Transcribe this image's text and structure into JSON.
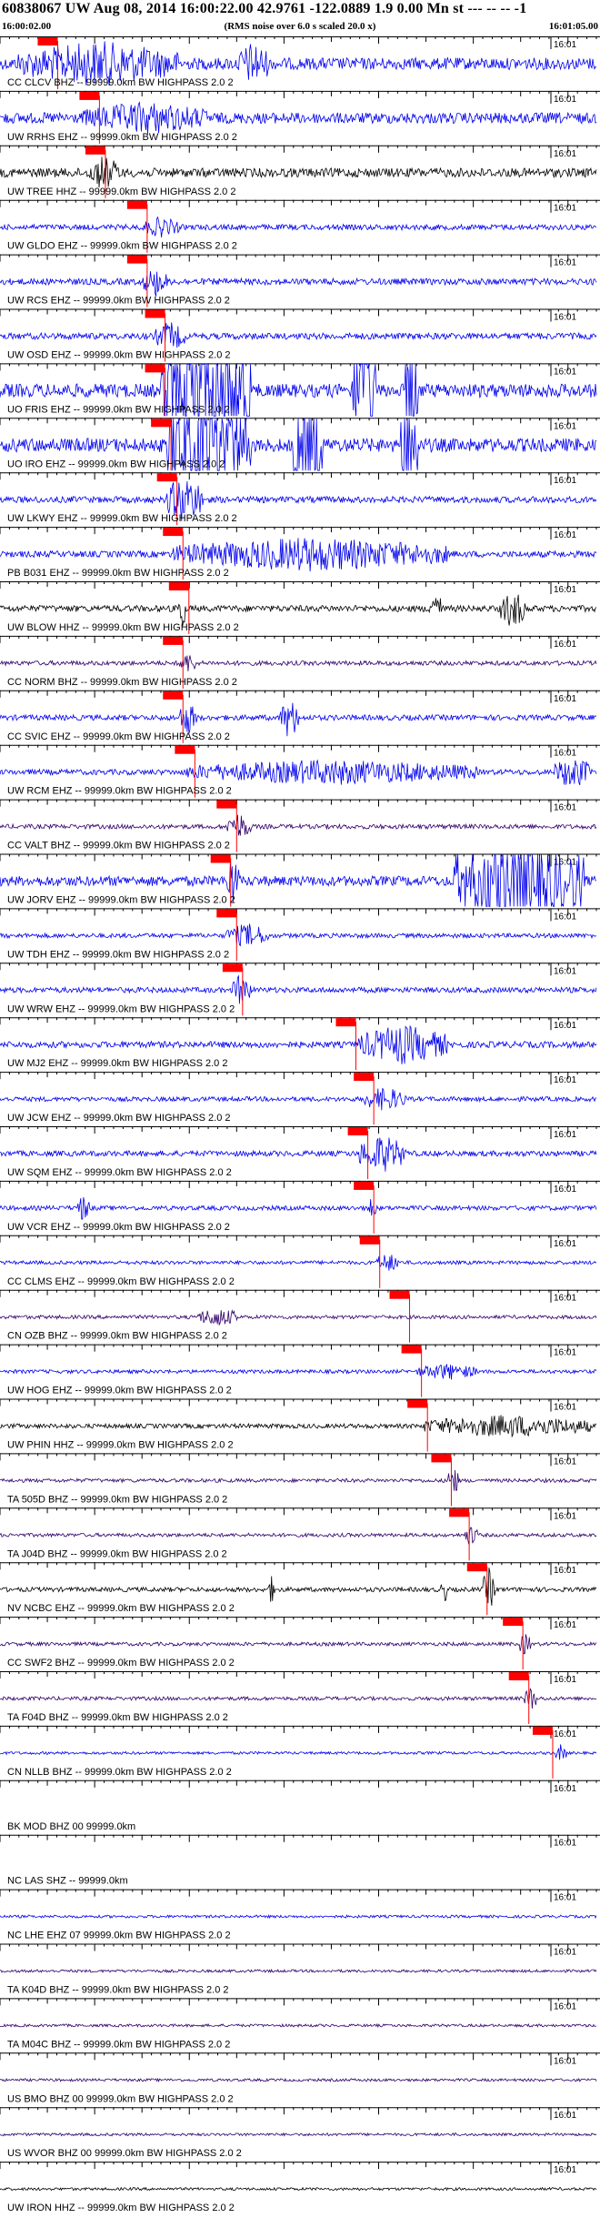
{
  "header": {
    "title": "60838067 UW Aug 08, 2014 16:00:22.00   42.9761 -122.0889  1.9 0.00 Mn st --- -- --   -1",
    "start_time": "16:00:02.00",
    "rms_note": "(RMS noise over 6.0 s scaled 20.0 x)",
    "end_time": "16:01:05.00"
  },
  "tick_label": "16:01",
  "colors": {
    "blue": "#0000ee",
    "black": "#000000",
    "purple": "#30006a",
    "pick": "#ff0000"
  },
  "traces": [
    {
      "label": "CC CLCV BHZ -- 99999.0km BW  HIGHPASS  2.0  2",
      "color": "blue",
      "pick": 0.08,
      "amp": 26,
      "bursts": [
        [
          0.03,
          0.3,
          1.0
        ],
        [
          0.4,
          0.45,
          1.0
        ]
      ]
    },
    {
      "label": "UW RRHS EHZ -- 99999.0km BW  HIGHPASS  2.0  2",
      "color": "blue",
      "pick": 0.15,
      "amp": 24,
      "bursts": [
        [
          0.14,
          0.35,
          0.8
        ]
      ]
    },
    {
      "label": "UW TREE HHZ -- 99999.0km BW  HIGHPASS  2.0  2",
      "color": "black",
      "pick": 0.16,
      "amp": 20,
      "bursts": [
        [
          0.15,
          0.2,
          1.0
        ]
      ]
    },
    {
      "label": "UW GLDO EHZ -- 99999.0km BW  HIGHPASS  2.0  2",
      "color": "blue",
      "pick": 0.23,
      "amp": 12,
      "bursts": [
        [
          0.24,
          0.3,
          1.0
        ]
      ]
    },
    {
      "label": "UW RCS EHZ -- 99999.0km BW  HIGHPASS  2.0  2",
      "color": "blue",
      "pick": 0.23,
      "amp": 14,
      "bursts": [
        [
          0.24,
          0.28,
          1.2
        ]
      ]
    },
    {
      "label": "UW OSD EHZ -- 99999.0km BW  HIGHPASS  2.0  2",
      "color": "blue",
      "pick": 0.26,
      "amp": 14,
      "bursts": [
        [
          0.26,
          0.31,
          1.2
        ]
      ]
    },
    {
      "label": "UO FRIS EHZ -- 99999.0km BW  HIGHPASS  2.0  2",
      "color": "blue",
      "pick": 0.26,
      "amp": 30,
      "bursts": [
        [
          0.27,
          0.42,
          3.0
        ],
        [
          0.59,
          0.63,
          3.0
        ],
        [
          0.68,
          0.7,
          3.0
        ]
      ]
    },
    {
      "label": "UO IRO EHZ -- 99999.0km BW  HIGHPASS  2.0  2",
      "color": "blue",
      "pick": 0.27,
      "amp": 30,
      "bursts": [
        [
          0.28,
          0.42,
          2.5
        ],
        [
          0.49,
          0.54,
          2.5
        ],
        [
          0.67,
          0.7,
          2.5
        ]
      ]
    },
    {
      "label": "UW LKWY EHZ -- 99999.0km BW  HIGHPASS  2.0  2",
      "color": "blue",
      "pick": 0.28,
      "amp": 14,
      "bursts": [
        [
          0.28,
          0.34,
          2.0
        ]
      ]
    },
    {
      "label": "PB B031 EHZ -- 99999.0km BW  HIGHPASS  2.0  2",
      "color": "blue",
      "pick": 0.29,
      "amp": 14,
      "bursts": [
        [
          0.29,
          0.75,
          1.4
        ]
      ]
    },
    {
      "label": "UW BLOW HHZ -- 99999.0km BW  HIGHPASS  2.0  2",
      "color": "black",
      "pick": 0.3,
      "amp": 14,
      "bursts": [
        [
          0.3,
          0.31,
          2.2
        ],
        [
          0.72,
          0.74,
          1.6
        ],
        [
          0.84,
          0.88,
          1.6
        ]
      ]
    },
    {
      "label": "CC NORM BHZ -- 99999.0km BW  HIGHPASS  2.0  2",
      "color": "purple",
      "pick": 0.29,
      "amp": 10,
      "bursts": [
        [
          0.3,
          0.33,
          1.2
        ]
      ]
    },
    {
      "label": "CC SVIC EHZ -- 99999.0km BW  HIGHPASS  2.0  2",
      "color": "blue",
      "pick": 0.29,
      "amp": 12,
      "bursts": [
        [
          0.3,
          0.33,
          1.6
        ],
        [
          0.47,
          0.5,
          2.0
        ]
      ]
    },
    {
      "label": "UW RCM EHZ -- 99999.0km BW  HIGHPASS  2.0  2",
      "color": "blue",
      "pick": 0.31,
      "amp": 12,
      "bursts": [
        [
          0.31,
          0.8,
          1.2
        ],
        [
          0.93,
          0.99,
          1.6
        ]
      ]
    },
    {
      "label": "CC VALT BHZ -- 99999.0km BW  HIGHPASS  2.0  2",
      "color": "purple",
      "pick": 0.38,
      "amp": 10,
      "bursts": [
        [
          0.38,
          0.42,
          1.6
        ]
      ]
    },
    {
      "label": "UW JORV EHZ -- 99999.0km BW  HIGHPASS  2.0  2",
      "color": "blue",
      "pick": 0.37,
      "amp": 22,
      "bursts": [
        [
          0.38,
          0.4,
          1.4
        ],
        [
          0.76,
          0.98,
          2.6
        ]
      ]
    },
    {
      "label": "UW TDH EHZ -- 99999.0km BW  HIGHPASS  2.0  2",
      "color": "blue",
      "pick": 0.38,
      "amp": 10,
      "bursts": [
        [
          0.38,
          0.45,
          1.4
        ]
      ]
    },
    {
      "label": "UW WRW EHZ -- 99999.0km BW  HIGHPASS  2.0  2",
      "color": "blue",
      "pick": 0.39,
      "amp": 12,
      "bursts": [
        [
          0.39,
          0.42,
          1.6
        ]
      ]
    },
    {
      "label": "UW MJ2 EHZ -- 99999.0km BW  HIGHPASS  2.0  2",
      "color": "blue",
      "pick": 0.58,
      "amp": 14,
      "bursts": [
        [
          0.6,
          0.75,
          1.6
        ]
      ]
    },
    {
      "label": "UW JCW EHZ -- 99999.0km BW  HIGHPASS  2.0  2",
      "color": "blue",
      "pick": 0.61,
      "amp": 10,
      "bursts": [
        [
          0.61,
          0.68,
          1.4
        ]
      ]
    },
    {
      "label": "UW SQM EHZ -- 99999.0km BW  HIGHPASS  2.0  2",
      "color": "blue",
      "pick": 0.6,
      "amp": 12,
      "bursts": [
        [
          0.6,
          0.68,
          1.8
        ]
      ]
    },
    {
      "label": "UW VCR EHZ -- 99999.0km BW  HIGHPASS  2.0  2",
      "color": "blue",
      "pick": 0.61,
      "amp": 10,
      "bursts": [
        [
          0.13,
          0.15,
          1.6
        ],
        [
          0.62,
          0.63,
          2.0
        ]
      ]
    },
    {
      "label": "CC CLMS EHZ -- 99999.0km BW  HIGHPASS  2.0  2",
      "color": "blue",
      "pick": 0.62,
      "amp": 8,
      "bursts": [
        [
          0.63,
          0.67,
          1.4
        ]
      ]
    },
    {
      "label": "CN OZB BHZ -- 99999.0km BW  HIGHPASS  2.0  2",
      "color": "purple",
      "pick": 0.67,
      "amp": 8,
      "bursts": [
        [
          0.33,
          0.4,
          1.4
        ]
      ]
    },
    {
      "label": "UW HOG EHZ -- 99999.0km BW  HIGHPASS  2.0  2",
      "color": "blue",
      "pick": 0.69,
      "amp": 8,
      "bursts": [
        [
          0.7,
          0.8,
          1.2
        ]
      ]
    },
    {
      "label": "UW PHIN HHZ -- 99999.0km BW  HIGHPASS  2.0  2",
      "color": "black",
      "pick": 0.7,
      "amp": 10,
      "bursts": [
        [
          0.71,
          0.99,
          1.3
        ]
      ]
    },
    {
      "label": "TA 505D BHZ -- 99999.0km BW  HIGHPASS  2.0  2",
      "color": "purple",
      "pick": 0.74,
      "amp": 8,
      "bursts": [
        [
          0.75,
          0.77,
          2.2
        ]
      ]
    },
    {
      "label": "TA J04D BHZ -- 99999.0km BW  HIGHPASS  2.0  2",
      "color": "purple",
      "pick": 0.77,
      "amp": 8,
      "bursts": [
        [
          0.78,
          0.8,
          1.6
        ]
      ]
    },
    {
      "label": "NV NCBC EHZ -- 99999.0km BW  HIGHPASS  2.0  2",
      "color": "black",
      "pick": 0.8,
      "amp": 10,
      "bursts": [
        [
          0.81,
          0.83,
          2.4
        ],
        [
          0.45,
          0.46,
          1.6
        ],
        [
          0.74,
          0.75,
          1.6
        ]
      ]
    },
    {
      "label": "CC SWF2 BHZ -- 99999.0km BW  HIGHPASS  2.0  2",
      "color": "purple",
      "pick": 0.86,
      "amp": 8,
      "bursts": [
        [
          0.87,
          0.89,
          1.6
        ]
      ]
    },
    {
      "label": "TA F04D BHZ -- 99999.0km BW  HIGHPASS  2.0  2",
      "color": "purple",
      "pick": 0.87,
      "amp": 8,
      "bursts": [
        [
          0.88,
          0.9,
          1.8
        ]
      ]
    },
    {
      "label": "CN NLLB BHZ -- 99999.0km BW  HIGHPASS  2.0  2",
      "color": "blue",
      "pick": 0.91,
      "amp": 6,
      "bursts": [
        [
          0.93,
          0.95,
          1.6
        ]
      ]
    },
    {
      "label": "BK MOD BHZ 00 99999.0km",
      "color": "blue",
      "pick": null,
      "amp": 0,
      "bursts": []
    },
    {
      "label": "NC LAS SHZ -- 99999.0km",
      "color": "blue",
      "pick": null,
      "amp": 0,
      "bursts": []
    },
    {
      "label": "NC LHE EHZ 07 99999.0km BW  HIGHPASS  2.0  2",
      "color": "blue",
      "pick": null,
      "amp": 6,
      "bursts": []
    },
    {
      "label": "TA K04D BHZ -- 99999.0km BW  HIGHPASS  2.0  2",
      "color": "purple",
      "pick": null,
      "amp": 6,
      "bursts": []
    },
    {
      "label": "TA M04C BHZ -- 99999.0km BW  HIGHPASS  2.0  2",
      "color": "purple",
      "pick": null,
      "amp": 6,
      "bursts": []
    },
    {
      "label": "US BMO BHZ 00 99999.0km BW  HIGHPASS  2.0  2",
      "color": "purple",
      "pick": null,
      "amp": 6,
      "bursts": []
    },
    {
      "label": "US WVOR BHZ 00 99999.0km BW  HIGHPASS  2.0  2",
      "color": "purple",
      "pick": null,
      "amp": 6,
      "bursts": []
    },
    {
      "label": "UW IRON HHZ -- 99999.0km BW  HIGHPASS  2.0  2",
      "color": "black",
      "pick": null,
      "amp": 6,
      "bursts": []
    }
  ]
}
